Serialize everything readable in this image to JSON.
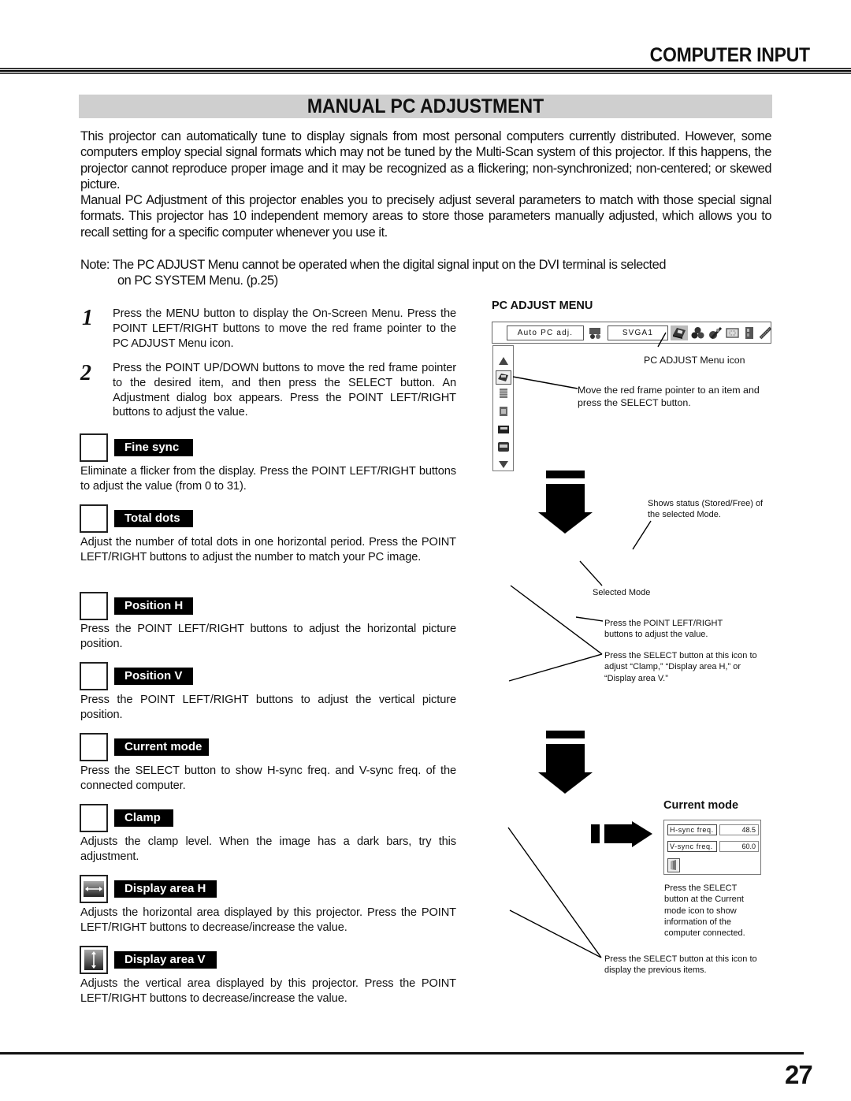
{
  "header": {
    "section_title": "COMPUTER INPUT",
    "page_title": "MANUAL PC ADJUSTMENT"
  },
  "intro": {
    "paragraph_1": "This projector can automatically tune to display signals from most personal computers currently distributed. However, some computers employ special signal formats which may not be tuned by the Multi-Scan system of this projector. If this happens, the projector cannot reproduce proper image and it may be recognized as a flickering; non-synchronized; non-centered; or skewed picture.",
    "paragraph_2": "Manual PC Adjustment of this projector enables you to precisely adjust several parameters to match with those special signal formats. This projector has 10 independent memory areas to store those parameters manually adjusted, which allows you to recall setting for a specific computer whenever you use it.",
    "note_line_1": "Note: The PC ADJUST Menu cannot be operated when the digital signal input on the DVI terminal is selected",
    "note_line_2": "on PC SYSTEM Menu. (p.25)"
  },
  "steps": [
    {
      "number": "1",
      "text": "Press the MENU button to display the On-Screen Menu. Press the POINT LEFT/RIGHT buttons to move the red frame pointer to the PC ADJUST Menu icon."
    },
    {
      "number": "2",
      "text": "Press the POINT UP/DOWN buttons to move the red frame pointer to the desired item, and then press the SELECT button.  An Adjustment dialog box appears. Press the POINT LEFT/RIGHT buttons to adjust the value."
    }
  ],
  "items": [
    {
      "label": "Fine sync",
      "icon": "blank-box-icon",
      "description": "Eliminate a flicker from the display. Press the POINT LEFT/RIGHT buttons to adjust the value (from 0 to 31)."
    },
    {
      "label": "Total dots",
      "icon": "blank-box-icon",
      "description": "Adjust the number of total dots in one horizontal period. Press the POINT LEFT/RIGHT buttons to adjust the number to match your PC image."
    },
    {
      "label": "Position H",
      "icon": "blank-box-icon",
      "description": "Press the POINT LEFT/RIGHT buttons to adjust the horizontal picture position."
    },
    {
      "label": "Position V",
      "icon": "blank-box-icon",
      "description": "Press the POINT LEFT/RIGHT buttons to adjust the vertical picture position."
    },
    {
      "label": "Current mode",
      "icon": "blank-box-icon",
      "description": "Press the SELECT button to show H-sync freq. and V-sync freq. of the connected computer."
    },
    {
      "label": "Clamp",
      "icon": "blank-box-icon",
      "description": "Adjusts the clamp level. When the image has a dark bars, try this adjustment."
    },
    {
      "label": "Display area H",
      "icon": "horizontal-arrows-icon",
      "description": "Adjusts the horizontal area displayed by this projector. Press the POINT LEFT/RIGHT buttons to decrease/increase the value."
    },
    {
      "label": "Display area V",
      "icon": "vertical-arrows-icon",
      "description": "Adjusts the vertical area displayed by this projector. Press the POINT LEFT/RIGHT buttons to decrease/increase the value."
    }
  ],
  "pc_adjust_menu": {
    "heading": "PC ADJUST MENU",
    "auto_field": "Auto PC adj.",
    "mode_field": "SVGA1",
    "menubar_icons": [
      "system-icon",
      "pc-adjust-icon",
      "color-icon",
      "image-adjust-icon",
      "screen-icon",
      "setting-icon",
      "expand-icon"
    ],
    "side_icons": [
      "scroll-up-icon",
      "fine-sync-icon",
      "total-dots-icon",
      "position-icon",
      "current-mode-icon",
      "clamp-icon",
      "scroll-down-icon"
    ],
    "callouts": {
      "menu_icon": "PC ADJUST Menu icon",
      "move_pointer": "Move the red frame pointer to an item and press the SELECT button.",
      "status": "Shows status (Stored/Free) of the selected Mode.",
      "selected_mode": "Selected Mode",
      "adjust_value": "Press the POINT LEFT/RIGHT buttons to adjust the value.",
      "select_more": "Press the SELECT button at this icon to adjust “Clamp,” “Display area H,” or “Display area V.”"
    }
  },
  "current_mode": {
    "heading": "Current mode",
    "rows": [
      {
        "label": "H-sync freq.",
        "value": "48.5"
      },
      {
        "label": "V-sync freq.",
        "value": "60.0"
      }
    ],
    "callouts": {
      "show_info": "Press the SELECT button at the Current mode icon to show information of the computer connected.",
      "previous": "Press the SELECT button at this icon to display the previous items."
    }
  },
  "footer": {
    "page_number": "27"
  }
}
